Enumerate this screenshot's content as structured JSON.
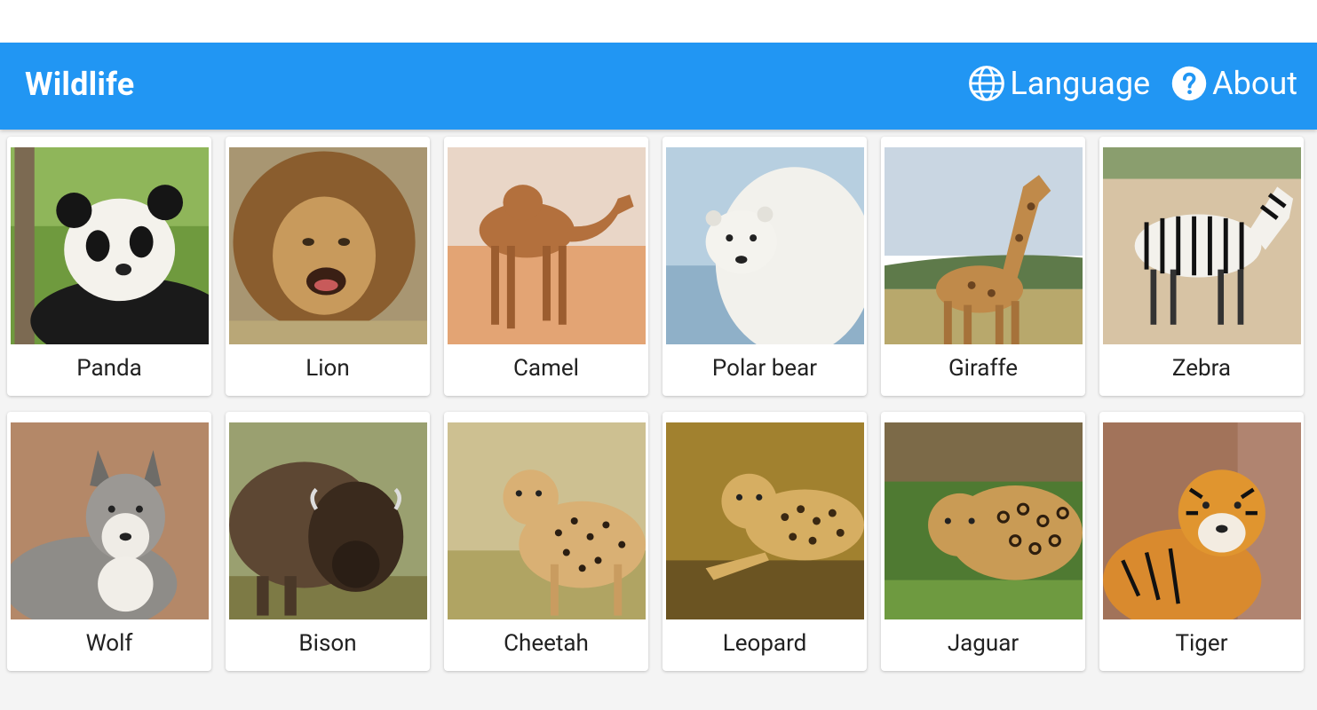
{
  "app": {
    "title": "Wildlife",
    "accent_color": "#2196F3",
    "actions": [
      {
        "label": "Language",
        "icon": "globe-icon"
      },
      {
        "label": "About",
        "icon": "help-circle-icon"
      }
    ]
  },
  "animals": [
    {
      "name": "Panda"
    },
    {
      "name": "Lion"
    },
    {
      "name": "Camel"
    },
    {
      "name": "Polar bear"
    },
    {
      "name": "Giraffe"
    },
    {
      "name": "Zebra"
    },
    {
      "name": "Wolf"
    },
    {
      "name": "Bison"
    },
    {
      "name": "Cheetah"
    },
    {
      "name": "Leopard"
    },
    {
      "name": "Jaguar"
    },
    {
      "name": "Tiger"
    }
  ]
}
